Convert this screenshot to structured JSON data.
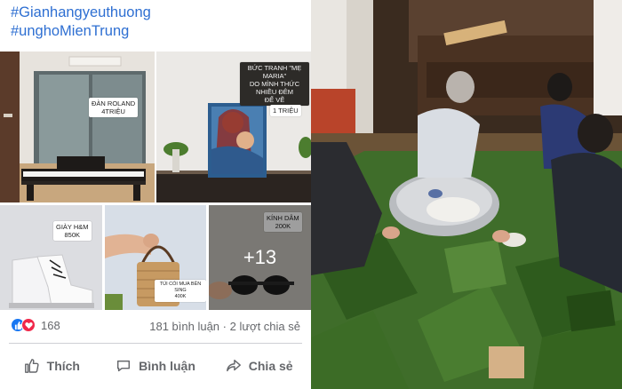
{
  "post": {
    "hashtags": [
      "#Gianhangyeuthuong",
      "#unghoMienTrung"
    ],
    "photos": {
      "piano": {
        "tag": [
          "ĐÀN ROLAND",
          "4TRIỆU"
        ]
      },
      "painting": {
        "tag_title": [
          "BỨC TRANH \"MẸ MARIA\"",
          "DO MÌNH THỨC NHIỀU ĐÊM",
          "ĐỂ VẼ"
        ],
        "tag_price": "1 TRIỆU"
      },
      "shoes": {
        "tag": [
          "GIÀY H&M",
          "850K"
        ]
      },
      "bag": {
        "tag": [
          "TÚI CÓI MUA BÊN SING",
          "400K"
        ]
      },
      "glasses": {
        "tag": [
          "KÍNH DÂM",
          "200K"
        ],
        "more_count": "+13"
      }
    },
    "reactions": {
      "count": "168",
      "icons": [
        "like-icon",
        "love-icon"
      ]
    },
    "comments": "181 bình luận",
    "separator": "·",
    "shares": "2 lượt chia sẻ",
    "actions": {
      "like": "Thích",
      "comment": "Bình luận",
      "share": "Chia sẻ"
    },
    "colors": {
      "hashtag": "#2e6fd2",
      "like": "#1877f2",
      "love": "#f0284a",
      "meta": "#65676b"
    }
  }
}
